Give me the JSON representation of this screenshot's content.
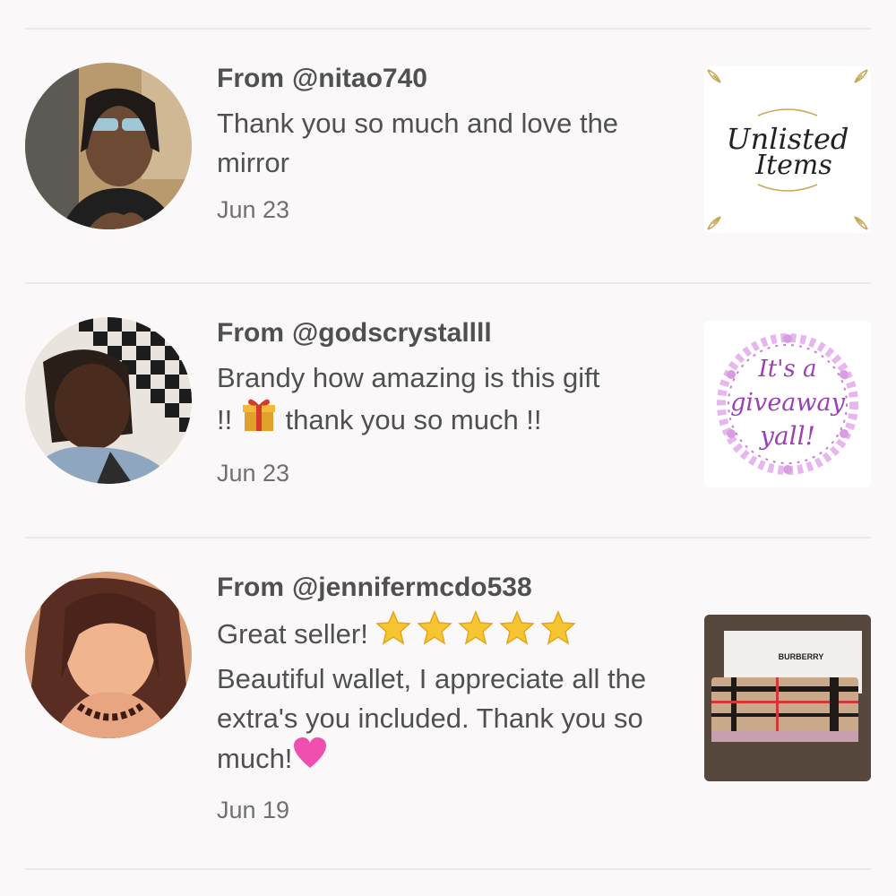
{
  "reviews": [
    {
      "from_prefix": "From",
      "username": "@nitao740",
      "message": "Thank you so much and love the mirror",
      "date": "Jun 23",
      "thumbnail": {
        "line1": "Unlisted",
        "line2": "Items"
      }
    },
    {
      "from_prefix": "From",
      "username": "@godscrystallll",
      "message_part1": "Brandy how amazing is this gift",
      "message_part2": "!!",
      "message_part3": "thank you so much !!",
      "date": "Jun 23",
      "thumbnail": {
        "line1": "It's a",
        "line2": "giveaway",
        "line3": "yall!"
      }
    },
    {
      "from_prefix": "From",
      "username": "@jennifermcdo538",
      "message_part1": "Great seller!",
      "message_part2": "Beautiful wallet, I appreciate all the extra's you included. Thank you so much!",
      "date": "Jun 19",
      "thumbnail": {
        "brand": "BURBERRY"
      }
    }
  ],
  "colors": {
    "background": "#fbf8fa",
    "divider": "#ebe7ea",
    "text": "#505050",
    "date": "#707070",
    "giveaway_purple": "#9b3fb5"
  },
  "icons": [
    "gift-emoji-icon",
    "star-emoji-icon",
    "pink-heart-emoji-icon"
  ]
}
